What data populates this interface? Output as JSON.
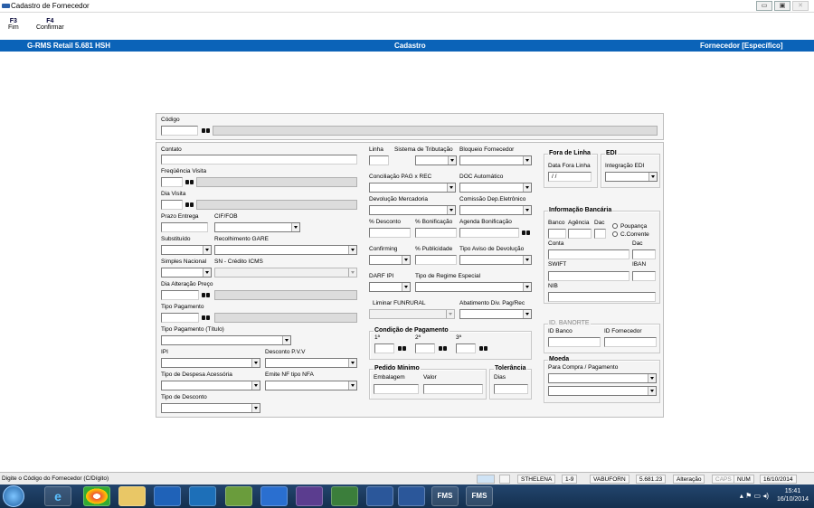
{
  "window": {
    "title": "Cadastro de Fornecedor",
    "min": "▭",
    "max": "▣",
    "close": "✕"
  },
  "fkeys": [
    {
      "key": "F3",
      "label": "Fim"
    },
    {
      "key": "F4",
      "label": "Confirmar"
    }
  ],
  "banner": {
    "left": "G-RMS Retail 5.681 HSH",
    "center": "Cadastro",
    "right": "Fornecedor [Específico]"
  },
  "form": {
    "codigo": "Código",
    "contato": "Contato",
    "frequencia": "Freqüência Visita",
    "dia_visita": "Dia Visita",
    "prazo": "Prazo Entrega",
    "cif": "CIF/FOB",
    "substituido": "Substituído",
    "gare": "Recolhimento GARE",
    "simples": "Simples Nacional",
    "sn_credito": "SN - Crédito ICMS",
    "dia_alt": "Dia Alteração Preço",
    "tipo_pag": "Tipo Pagamento",
    "tipo_pag_titulo": "Tipo Pagamento (Título)",
    "ipi": "IPI",
    "desconto_pvv": "Desconto P.V.V",
    "despesa": "Tipo de Despesa Acessória",
    "emite_nf": "Emite NF tipo NFA",
    "tipo_desconto": "Tipo de Desconto",
    "linha": "Linha",
    "sist_trib": "Sistema de Tributação",
    "bloqueio": "Bloqueio Fornecedor",
    "conciliacao": "Conciliação PAG x REC",
    "doc_auto": "DOC Automático",
    "devolucao": "Devolução Mercadoria",
    "comissao": "Comissão Dep.Eletrônico",
    "pct_desc": "% Desconto",
    "pct_bonif": "% Bonificação",
    "agenda_bonif": "Agenda Bonificação",
    "confirming": "Confirming",
    "pct_public": "% Publicidade",
    "aviso_dev": "Tipo Aviso de Devolução",
    "darf": "DARF IPI",
    "regime": "Tipo de Regime Especial",
    "funrural": "Liminar FUNRURAL",
    "abatimento": "Abatimento Div. Pag/Rec",
    "cond_pag": "Condição de Pagamento",
    "c1": "1ª",
    "c2": "2ª",
    "c3": "3ª",
    "pedido_min": "Pedido Mínimo",
    "embalagem": "Embalagem",
    "valor": "Valor",
    "tolerancia": "Tolerância",
    "dias": "Dias",
    "fora_linha": "Fora de Linha",
    "data_fora": "Data Fora Linha",
    "data_fora_val": " / /",
    "edi": "EDI",
    "integracao": "Integração EDI",
    "info_banc": "Informação Bancária",
    "banco": "Banco",
    "agencia": "Agência",
    "dac": "Dac",
    "poupanca": "Poupança",
    "ccorrente": "C.Corrente",
    "conta": "Conta",
    "dac2": "Dac",
    "swift": "SWIFT",
    "iban": "IBAN",
    "nib": "NIB",
    "id_banorte": "ID. BANORTE",
    "id_banco": "ID Banco",
    "id_fornec": "ID Fornecedor",
    "moeda": "Moeda",
    "moeda_sub": "Para Compra / Pagamento"
  },
  "status": {
    "hint": "Digite o Código do Fornecedor (C/Dígito)",
    "user": "STHELENA",
    "c1": "1-9",
    "prog": "VABUFORN",
    "ver": "5.681.23",
    "mode": "Alteração",
    "caps": "CAPS",
    "num": "NUM",
    "date": "16/10/2014"
  },
  "taskbar": {
    "fms1": "FMS",
    "fms2": "FMS",
    "time": "15:41",
    "date": "16/10/2014"
  }
}
